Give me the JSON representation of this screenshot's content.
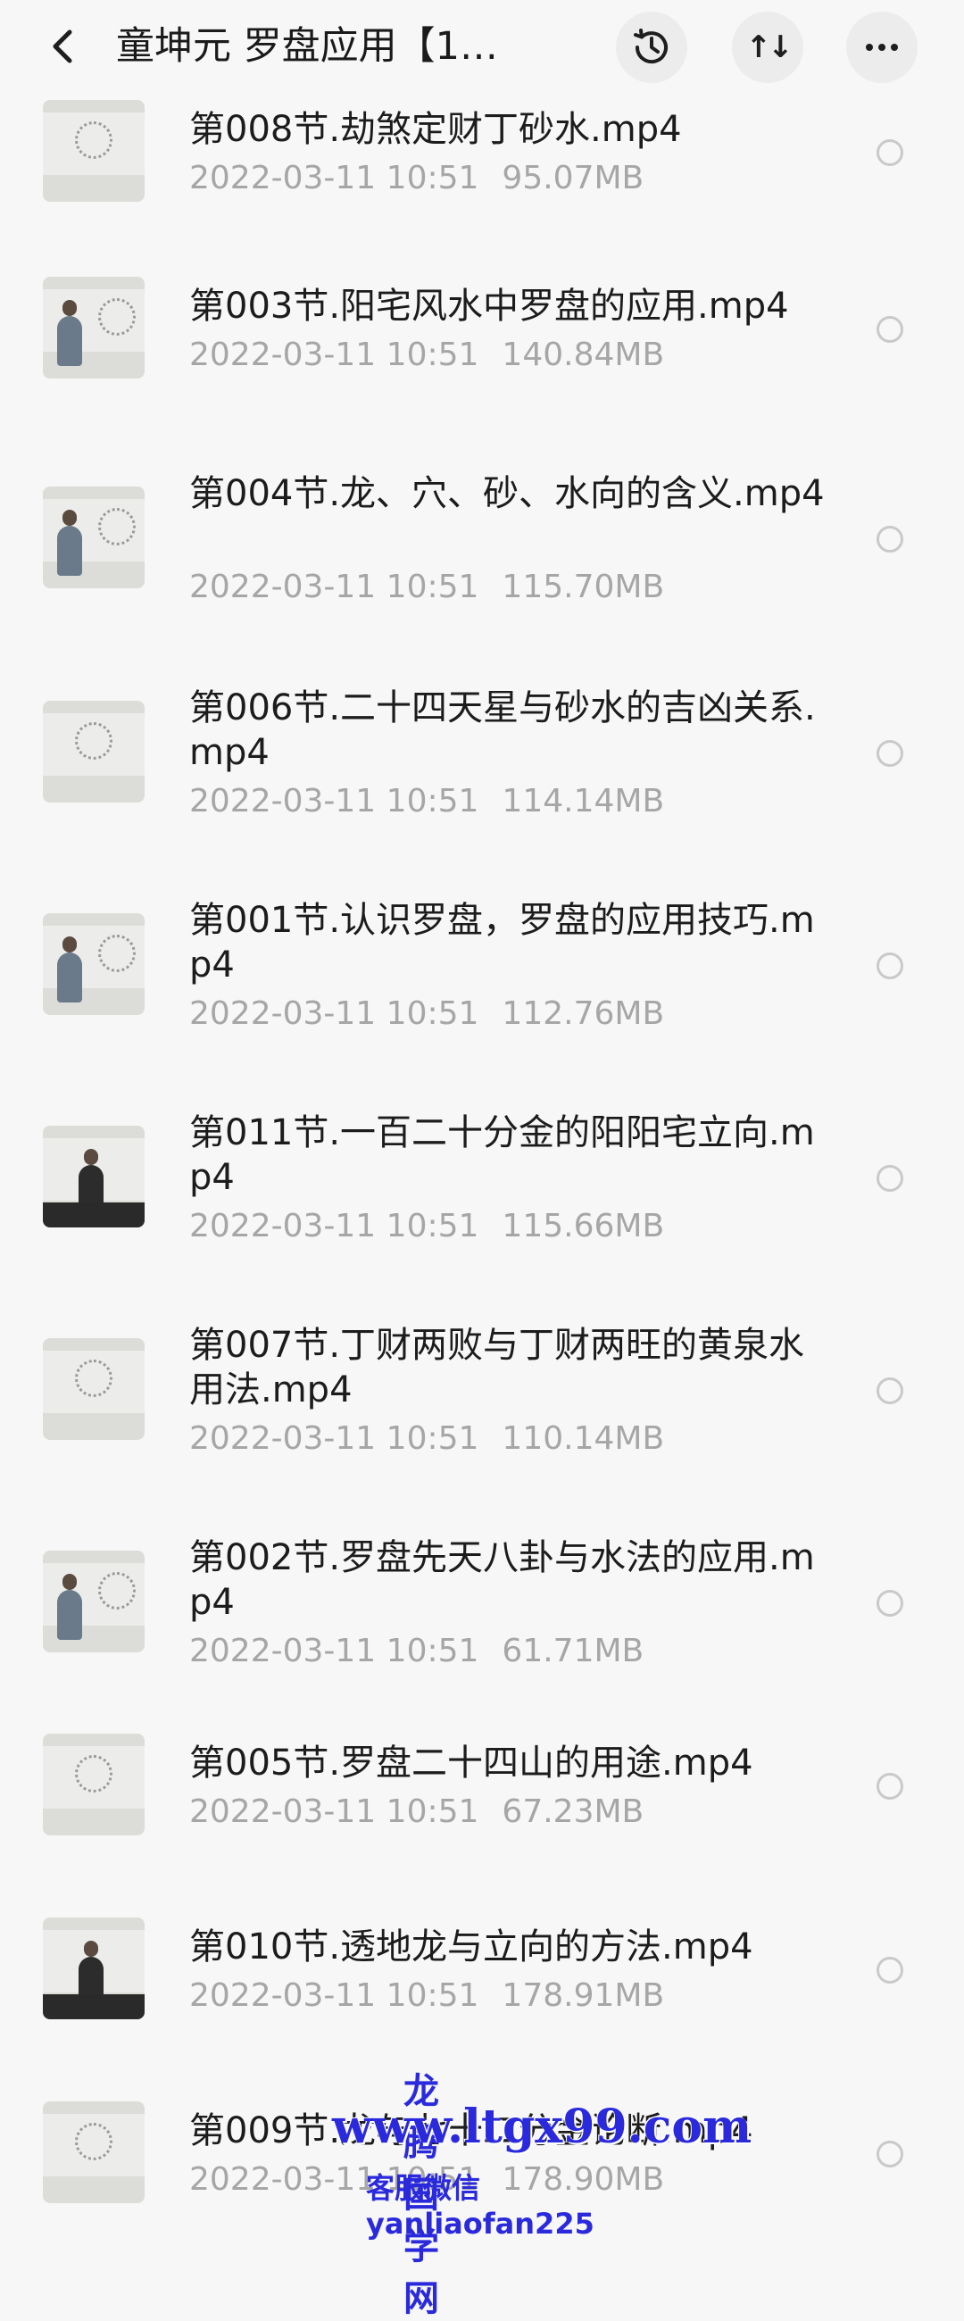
{
  "header": {
    "title": "童坤元 罗盘应用【1…",
    "sort_label": "↑↓",
    "icons": {
      "back": "back-chevron-icon",
      "history": "clock-history-icon",
      "sort": "sort-icon",
      "more": "more-dots-icon"
    }
  },
  "files": [
    {
      "name": "第008节.劫煞定财丁砂水.mp4",
      "date": "2022-03-11",
      "time": "10:51",
      "size": "95.07MB",
      "thumb": "compass"
    },
    {
      "name": "第003节.阳宅风水中罗盘的应用.mp4",
      "date": "2022-03-11",
      "time": "10:51",
      "size": "140.84MB",
      "thumb": "person"
    },
    {
      "name": "第004节.龙、穴、砂、水向的含义.mp4",
      "date": "2022-03-11",
      "time": "10:51",
      "size": "115.70MB",
      "thumb": "person"
    },
    {
      "name": "第006节.二十四天星与砂水的吉凶关系.mp4",
      "date": "2022-03-11",
      "time": "10:51",
      "size": "114.14MB",
      "thumb": "compass"
    },
    {
      "name": "第001节.认识罗盘，罗盘的应用技巧.mp4",
      "date": "2022-03-11",
      "time": "10:51",
      "size": "112.76MB",
      "thumb": "person"
    },
    {
      "name": "第011节.一百二十分金的阳阳宅立向.mp4",
      "date": "2022-03-11",
      "time": "10:51",
      "size": "115.66MB",
      "thumb": "person-dark"
    },
    {
      "name": "第007节.丁财两败与丁财两旺的黄泉水用法.mp4",
      "date": "2022-03-11",
      "time": "10:51",
      "size": "110.14MB",
      "thumb": "compass"
    },
    {
      "name": "第002节.罗盘先天八卦与水法的应用.mp4",
      "date": "2022-03-11",
      "time": "10:51",
      "size": "61.71MB",
      "thumb": "person"
    },
    {
      "name": "第005节.罗盘二十四山的用途.mp4",
      "date": "2022-03-11",
      "time": "10:51",
      "size": "67.23MB",
      "thumb": "compass"
    },
    {
      "name": "第010节.透地龙与立向的方法.mp4",
      "date": "2022-03-11",
      "time": "10:51",
      "size": "178.91MB",
      "thumb": "person-dark"
    },
    {
      "name": "第009节.龙与七十二分金论断.mp4",
      "date": "2022-03-11",
      "time": "10:51",
      "size": "178.90MB",
      "thumb": "compass"
    }
  ],
  "watermark": {
    "site_name": "龙腾国学网",
    "url": "www.ltgx99.com",
    "contact": "客服微信 yanliaofan225"
  }
}
